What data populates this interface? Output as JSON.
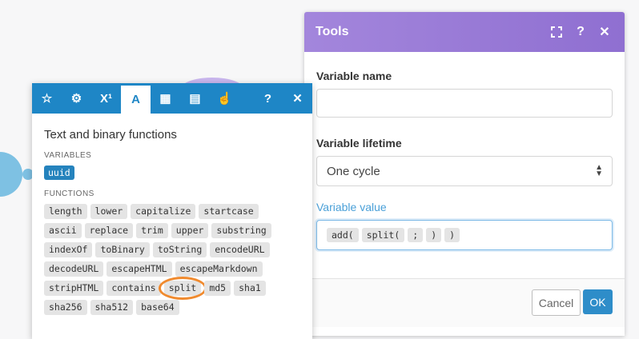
{
  "tools": {
    "title": "Tools",
    "variable_name_label": "Variable name",
    "variable_name_value": "",
    "variable_lifetime_label": "Variable lifetime",
    "variable_lifetime_value": "One cycle",
    "variable_value_label": "Variable value",
    "variable_value_tokens": [
      "add(",
      "split(",
      ";",
      ")",
      ")"
    ],
    "cancel_label": "Cancel",
    "ok_label": "OK"
  },
  "picker": {
    "tabs": [
      {
        "icon": "star-icon",
        "glyph": "☆"
      },
      {
        "icon": "gear-icon",
        "glyph": "⚙"
      },
      {
        "icon": "superscript-icon",
        "glyph": "X¹"
      },
      {
        "icon": "text-icon",
        "glyph": "A"
      },
      {
        "icon": "calendar-icon",
        "glyph": "▦"
      },
      {
        "icon": "table-icon",
        "glyph": "▤"
      },
      {
        "icon": "hand-icon",
        "glyph": "☝"
      }
    ],
    "title": "Text and binary functions",
    "variables_label": "VARIABLES",
    "variables": [
      "uuid"
    ],
    "functions_label": "FUNCTIONS",
    "functions": [
      "length",
      "lower",
      "capitalize",
      "startcase",
      "ascii",
      "replace",
      "trim",
      "upper",
      "substring",
      "indexOf",
      "toBinary",
      "toString",
      "encodeURL",
      "decodeURL",
      "escapeHTML",
      "escapeMarkdown",
      "stripHTML",
      "contains",
      "split",
      "md5",
      "sha1",
      "sha256",
      "sha512",
      "base64"
    ],
    "highlighted_function": "split"
  },
  "colors": {
    "tools_header": "#9b7ed9",
    "picker_header": "#1e86c6",
    "highlight_ring": "#f08a2e",
    "ok_button": "#2e8dc9"
  }
}
